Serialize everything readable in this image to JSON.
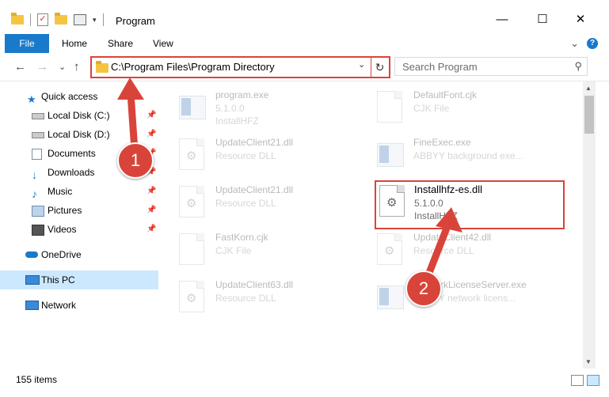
{
  "window": {
    "title": "Program",
    "minimize_glyph": "—",
    "maximize_glyph": "☐",
    "close_glyph": "✕"
  },
  "ribbon": {
    "tabs": [
      "File",
      "Home",
      "Share",
      "View"
    ],
    "expand_glyph": "⌄",
    "help_glyph": "?"
  },
  "nav": {
    "back_glyph": "←",
    "forward_glyph": "→",
    "dropdown_glyph": "⌄",
    "up_glyph": "↑",
    "address": "C:\\Program Files\\Program Directory",
    "refresh_glyph": "↻",
    "search_placeholder": "Search Program",
    "search_glyph": "⚲"
  },
  "sidebar": {
    "items": [
      {
        "label": "Quick access",
        "icon": "star-icon",
        "pinned": false
      },
      {
        "label": "Local Disk (C:)",
        "icon": "drive-icon",
        "pinned": true
      },
      {
        "label": "Local Disk (D:)",
        "icon": "drive-icon",
        "pinned": true
      },
      {
        "label": "Documents",
        "icon": "documents-icon",
        "pinned": true
      },
      {
        "label": "Downloads",
        "icon": "downloads-icon",
        "pinned": true
      },
      {
        "label": "Music",
        "icon": "music-icon",
        "pinned": true
      },
      {
        "label": "Pictures",
        "icon": "pictures-icon",
        "pinned": true
      },
      {
        "label": "Videos",
        "icon": "videos-icon",
        "pinned": true
      },
      {
        "label": "OneDrive",
        "icon": "cloud-icon",
        "pinned": false
      },
      {
        "label": "This PC",
        "icon": "computer-icon",
        "pinned": false,
        "selected": true
      },
      {
        "label": "Network",
        "icon": "network-icon",
        "pinned": false
      }
    ],
    "pin_glyph": "📌"
  },
  "files": [
    {
      "name": "program.exe",
      "line1": "5.1.0.0",
      "line2": "InstallHFZ",
      "icon": "installer-icon"
    },
    {
      "name": "DefaultFont.cjk",
      "line1": "CJK File",
      "line2": "",
      "icon": "document-icon"
    },
    {
      "name": "UpdateClient21.dll",
      "line1": "Resource DLL",
      "line2": "",
      "icon": "dll-icon"
    },
    {
      "name": "FineExec.exe",
      "line1": "ABBYY background exe...",
      "line2": "",
      "icon": "exe-icon"
    },
    {
      "name": "UpdateClient21.dll",
      "line1": "Resource DLL",
      "line2": "",
      "icon": "dll-icon"
    },
    {
      "name": "Installhfz-es.dll",
      "line1": "5.1.0.0",
      "line2": "InstallHFZ",
      "icon": "dll-icon",
      "highlighted": true
    },
    {
      "name": "FastKorn.cjk",
      "line1": "CJK File",
      "line2": "",
      "icon": "document-icon"
    },
    {
      "name": "UpdateClient42.dll",
      "line1": "Resource DLL",
      "line2": "",
      "icon": "dll-icon"
    },
    {
      "name": "UpdateClient63.dll",
      "line1": "Resource DLL",
      "line2": "",
      "icon": "dll-icon"
    },
    {
      "name": "NetworkLicenseServer.exe",
      "line1": "ABBYY network licens...",
      "line2": "",
      "icon": "exe-icon"
    }
  ],
  "status": {
    "item_count": "155 items"
  },
  "callouts": [
    "1",
    "2"
  ],
  "colors": {
    "accent": "#1979ca",
    "highlight_red": "#d9443a",
    "selected_bg": "#cce8ff"
  }
}
